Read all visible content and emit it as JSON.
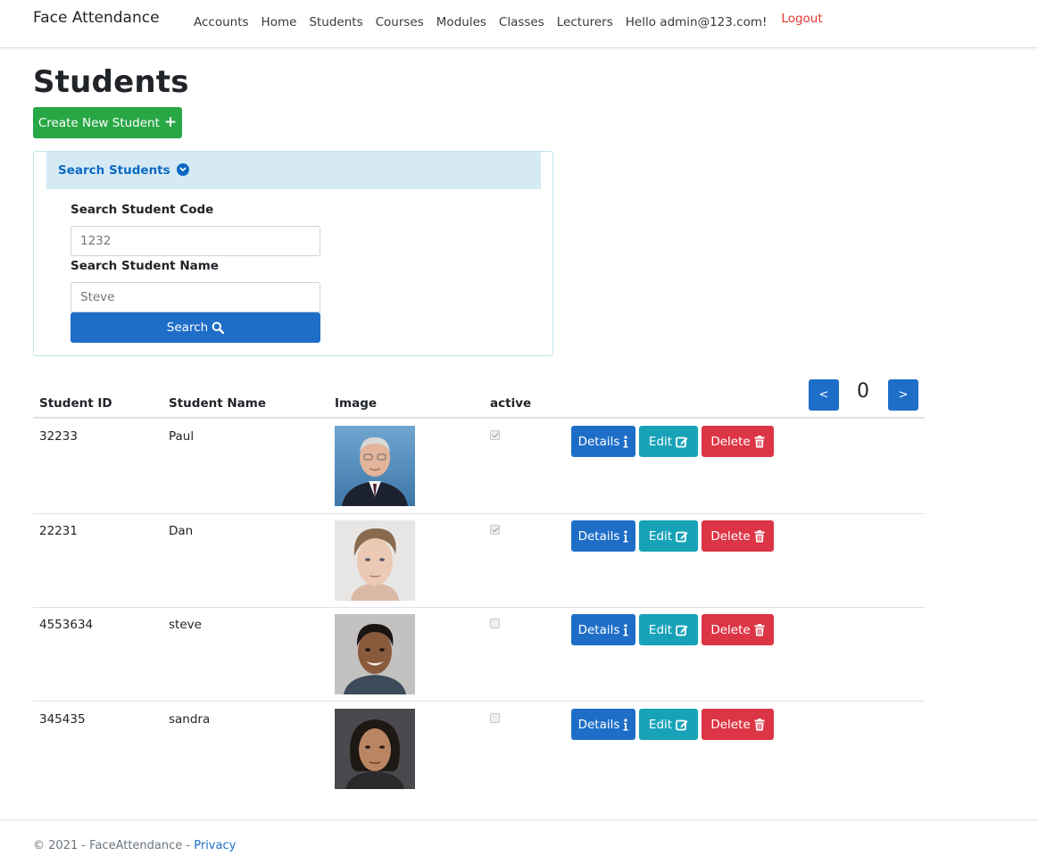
{
  "nav": {
    "brand": "Face Attendance",
    "links": [
      "Accounts",
      "Home",
      "Students",
      "Courses",
      "Modules",
      "Classes",
      "Lecturers",
      "Hello admin@123.com!"
    ],
    "logout": "Logout"
  },
  "page": {
    "title": "Students",
    "create_label": "Create New Student"
  },
  "search": {
    "header": "Search Students",
    "code_label": "Search Student Code",
    "code_placeholder": "1232",
    "name_label": "Search Student Name",
    "name_placeholder": "Steve",
    "button_label": "Search"
  },
  "pager": {
    "prev": "<",
    "page": "0",
    "next": ">"
  },
  "table": {
    "columns": [
      "Student ID",
      "Student Name",
      "Image",
      "active"
    ],
    "rows": [
      {
        "id": "32233",
        "name": "Paul",
        "active": true,
        "photo": "older-man-portrait"
      },
      {
        "id": "22231",
        "name": "Dan",
        "active": true,
        "photo": "young-man-portrait"
      },
      {
        "id": "4553634",
        "name": "steve",
        "active": false,
        "photo": "smiling-man-portrait"
      },
      {
        "id": "345435",
        "name": "sandra",
        "active": false,
        "photo": "woman-portrait"
      }
    ],
    "actions": {
      "details": "Details",
      "edit": "Edit",
      "delete": "Delete"
    }
  },
  "footer": {
    "text": "© 2021 - FaceAttendance - ",
    "link": "Privacy"
  },
  "colors": {
    "primary": "#1e6ec8",
    "success": "#28a745",
    "info": "#17a2b8",
    "danger": "#dc3545",
    "search_header_bg": "#d6eaf5"
  },
  "icons": [
    "plus-icon",
    "chevron-down-circle-icon",
    "search-icon",
    "info-icon",
    "edit-icon",
    "trash-icon"
  ]
}
